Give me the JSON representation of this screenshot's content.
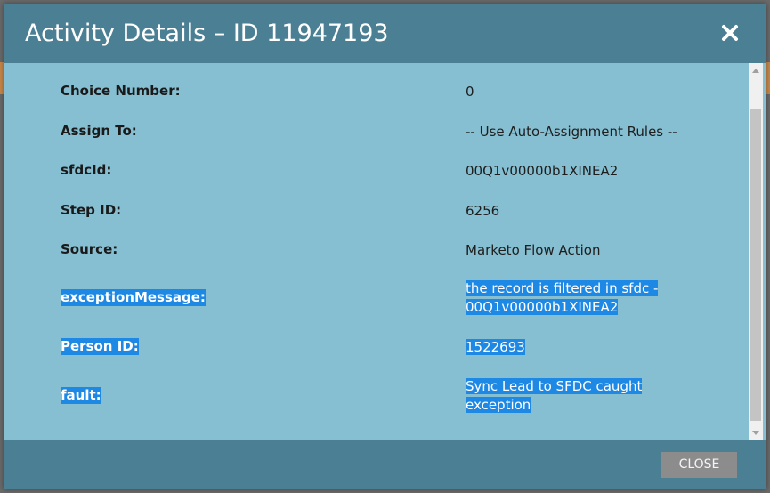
{
  "modal": {
    "title": "Activity Details – ID 11947193",
    "close_icon": "close-icon",
    "close_button_label": "CLOSE"
  },
  "details": [
    {
      "label": "Choice Number:",
      "value": "0",
      "selected": false
    },
    {
      "label": "Assign To:",
      "value": "-- Use Auto-Assignment Rules --",
      "selected": false
    },
    {
      "label": "sfdcId:",
      "value": "00Q1v00000b1XINEA2",
      "selected": false
    },
    {
      "label": "Step ID:",
      "value": "6256",
      "selected": false
    },
    {
      "label": "Source:",
      "value": "Marketo Flow Action",
      "selected": false
    },
    {
      "label": "exceptionMessage:",
      "value_lines": [
        "the record is filtered in sfdc -",
        "00Q1v00000b1XINEA2"
      ],
      "selected": true
    },
    {
      "label": "Person ID:",
      "value": "1522693",
      "selected": true
    },
    {
      "label": "fault:",
      "value_lines": [
        "Sync Lead to SFDC caught",
        "exception"
      ],
      "selected": true
    }
  ],
  "colors": {
    "header": "#4b7f93",
    "body": "#86bfd1",
    "selection": "#1e88e5"
  }
}
